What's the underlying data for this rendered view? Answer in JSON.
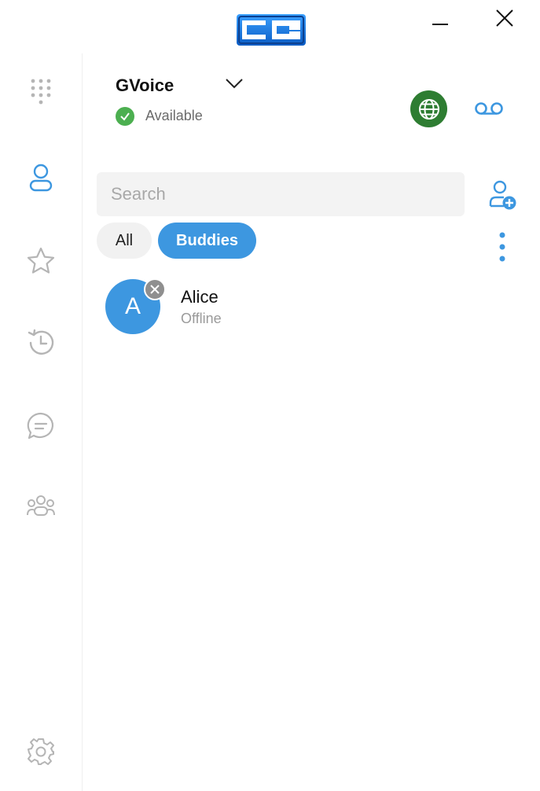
{
  "app": {
    "logo_icon": "cc-logo-icon",
    "window_controls": [
      "minimize-icon",
      "close-icon"
    ]
  },
  "sidebar": {
    "items": [
      {
        "id": "dialpad",
        "icon": "dialpad-icon"
      },
      {
        "id": "contacts",
        "icon": "person-icon",
        "active": true
      },
      {
        "id": "favorites",
        "icon": "star-icon"
      },
      {
        "id": "history",
        "icon": "history-icon"
      },
      {
        "id": "chat",
        "icon": "chat-icon"
      },
      {
        "id": "groups",
        "icon": "group-icon"
      },
      {
        "id": "settings",
        "icon": "gear-icon"
      }
    ]
  },
  "account": {
    "name": "GVoice",
    "status": "Available"
  },
  "search": {
    "placeholder": "Search",
    "value": ""
  },
  "filters": {
    "all_label": "All",
    "buddies_label": "Buddies",
    "selected": "Buddies"
  },
  "contacts": [
    {
      "initial": "A",
      "name": "Alice",
      "status": "Offline"
    }
  ],
  "colors": {
    "accent": "#3d97e0",
    "status_available": "#4caf50",
    "globe_button": "#2e7d32",
    "logo_blue": "#1565c0"
  }
}
